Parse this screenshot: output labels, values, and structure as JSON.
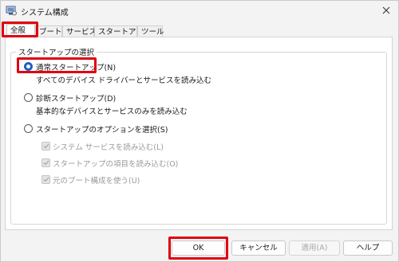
{
  "window": {
    "title": "システム構成",
    "icon": "system-configuration-icon"
  },
  "tabs": [
    {
      "label": "全般",
      "active": true
    },
    {
      "label": "ブート",
      "active": false
    },
    {
      "label": "サービス",
      "active": false
    },
    {
      "label": "スタートアップ",
      "active": false
    },
    {
      "label": "ツール",
      "active": false
    }
  ],
  "startup_selection": {
    "group_label": "スタートアップの選択",
    "normal": {
      "label": "通常スタートアップ(N)",
      "description": "すべてのデバイス ドライバーとサービスを読み込む",
      "selected": true
    },
    "diagnostic": {
      "label": "診断スタートアップ(D)",
      "description": "基本的なデバイスとサービスのみを読み込む",
      "selected": false
    },
    "selective": {
      "label": "スタートアップのオプションを選択(S)",
      "selected": false
    },
    "selective_options": [
      {
        "label": "システム サービスを読み込む(L)",
        "checked": true,
        "enabled": false
      },
      {
        "label": "スタートアップの項目を読み込む(O)",
        "checked": true,
        "enabled": false
      },
      {
        "label": "元のブート構成を使う(U)",
        "checked": true,
        "enabled": false
      }
    ]
  },
  "buttons": {
    "ok": "OK",
    "cancel": "キャンセル",
    "apply": "適用(A)",
    "help": "ヘルプ"
  },
  "colors": {
    "highlight": "#e00010",
    "accent": "#1f5fbf"
  }
}
